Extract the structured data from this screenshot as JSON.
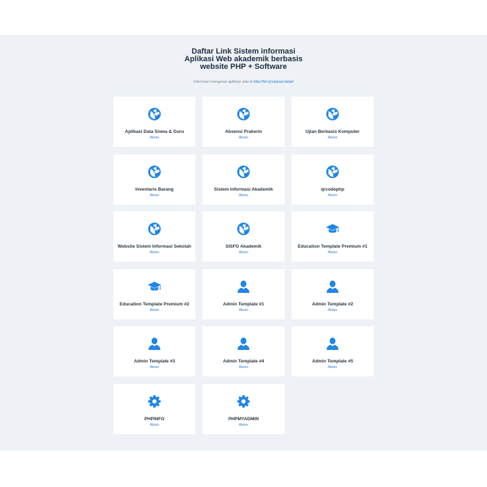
{
  "header": {
    "title_lines": [
      "Daftar Link Sistem informasi",
      "Aplikasi Web akademik berbasis",
      "website PHP + Software"
    ],
    "subtitle_prefix": "Informasi mengenai aplikasi ada di ",
    "subtitle_link": "http://bit.ly/siakad-detail"
  },
  "colors": {
    "accent": "#1f86e6",
    "panel": "#eef2f6",
    "card": "#ffffff"
  },
  "cards": [
    {
      "name": "Aplikasi Data Siswa & Guru",
      "link": "Akses",
      "icon": "globe-icon"
    },
    {
      "name": "Absensi Prakerin",
      "link": "Akses",
      "icon": "globe-icon"
    },
    {
      "name": "Ujian Berbasis Komputer",
      "link": "Akses",
      "icon": "globe-icon"
    },
    {
      "name": "Inventaris Barang",
      "link": "Akses",
      "icon": "globe-icon"
    },
    {
      "name": "Sistem Informasi Akademik",
      "link": "Akses",
      "icon": "globe-icon"
    },
    {
      "name": "qrcodephp",
      "link": "Akses",
      "icon": "globe-icon"
    },
    {
      "name": "Website Sistem Informasi Sekolah",
      "link": "Akses",
      "icon": "globe-icon"
    },
    {
      "name": "SISFO Akademik",
      "link": "Akses",
      "icon": "globe-icon"
    },
    {
      "name": "Education Template Premium #1",
      "link": "Akses",
      "icon": "graduation-cap-icon"
    },
    {
      "name": "Education Template Premium #2",
      "link": "Akses",
      "icon": "graduation-cap-icon"
    },
    {
      "name": "Admin Template #1",
      "link": "Akses",
      "icon": "user-icon"
    },
    {
      "name": "Admin Template #2",
      "link": "Akses",
      "icon": "user-icon"
    },
    {
      "name": "Admin Template #3",
      "link": "Akses",
      "icon": "user-icon"
    },
    {
      "name": "Admin Template #4",
      "link": "Akses",
      "icon": "user-icon"
    },
    {
      "name": "Admin Template #5",
      "link": "Akses",
      "icon": "user-icon"
    },
    {
      "name": "PHPINFO",
      "link": "Akses",
      "icon": "gear-icon"
    },
    {
      "name": "PHPMYADMIN",
      "link": "Akses",
      "icon": "gear-icon"
    }
  ]
}
